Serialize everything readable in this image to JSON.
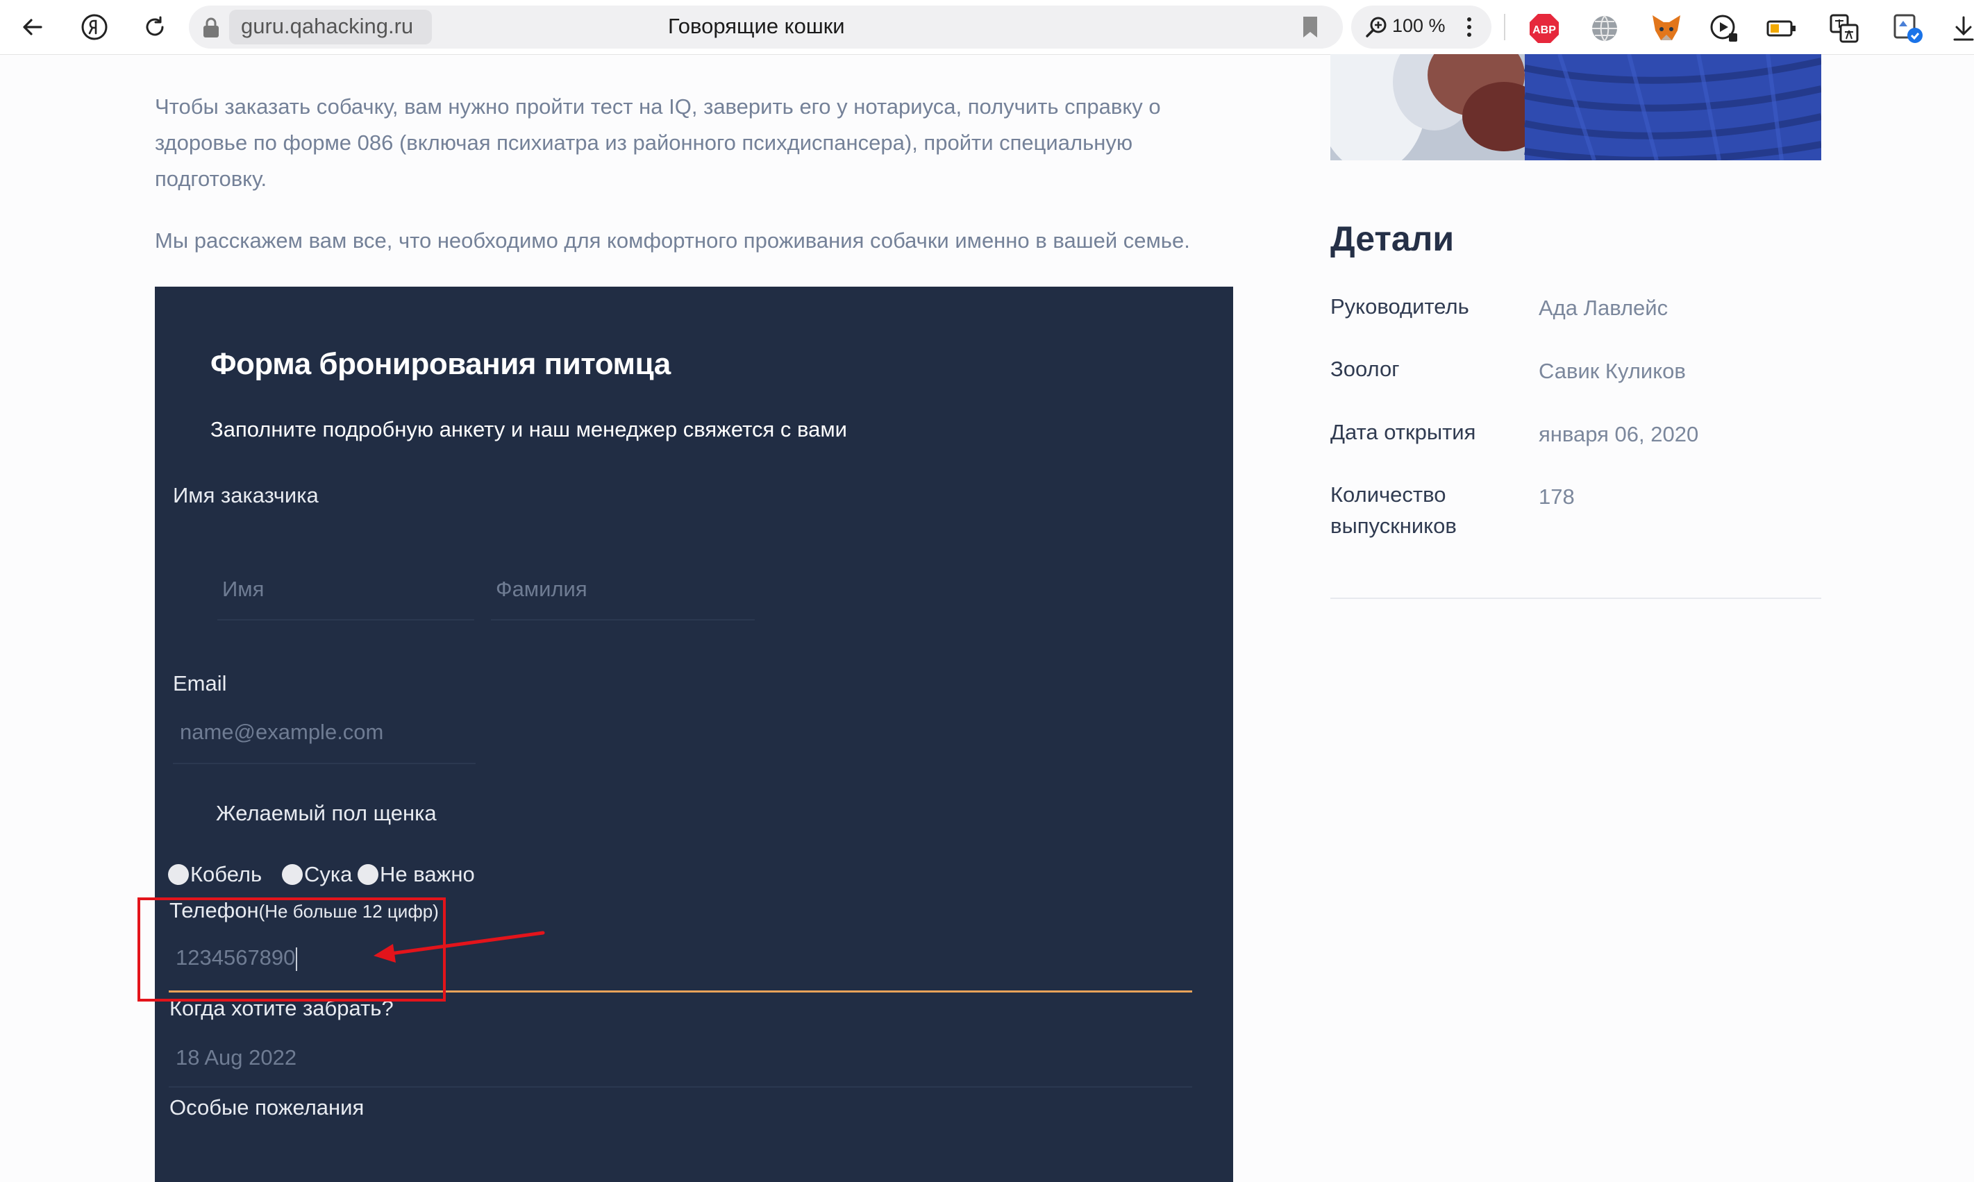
{
  "browser": {
    "url_host": "guru.qahacking.ru",
    "tab_title": "Говорящие кошки",
    "zoom": "100 %",
    "extensions": [
      "adblock-plus-icon",
      "globe-icon",
      "fox-wallet-icon",
      "video-play-icon",
      "battery-icon",
      "translate-icon",
      "profile-check-icon"
    ],
    "adblock_label": "ABP"
  },
  "article": {
    "paragraph_1": "Чтобы заказать собачку, вам нужно пройти тест на IQ, заверить его у нотариуса, получить справку о здоровье по форме 086 (включая психиатра из районного психдиспансера), пройти специальную подготовку.",
    "paragraph_2": "Мы расскажем вам все, что необходимо для комфортного проживания собачки именно в вашей семье."
  },
  "form": {
    "title": "Форма бронирования питомца",
    "subtitle": "Заполните подробную анкету и наш менеджер свяжется с вами",
    "name_label": "Имя заказчика",
    "first_name_placeholder": "Имя",
    "last_name_placeholder": "Фамилия",
    "email_label": "Email",
    "email_placeholder": "name@example.com",
    "gender_label": "Желаемый пол щенка",
    "gender_options": [
      "Кобель",
      "Сука",
      "Не важно"
    ],
    "phone_label": "Телефон",
    "phone_hint": "(Не больше 12 цифр)",
    "phone_value": "1234567890",
    "pickup_label": "Когда хотите забрать?",
    "pickup_value": "18 Aug 2022",
    "wishes_label": "Особые пожелания",
    "colors": {
      "panel": "#212d44",
      "focus_line": "#e8a25a",
      "annotation": "#e3141b"
    }
  },
  "sidebar": {
    "heading": "Детали",
    "details": [
      {
        "label": "Руководитель",
        "value": "Ада Лавлейс"
      },
      {
        "label": "Зоолог",
        "value": "Савик Куликов"
      },
      {
        "label": "Дата открытия",
        "value": "января 06, 2020"
      },
      {
        "label": "Количество выпускников",
        "value": "178"
      }
    ]
  }
}
